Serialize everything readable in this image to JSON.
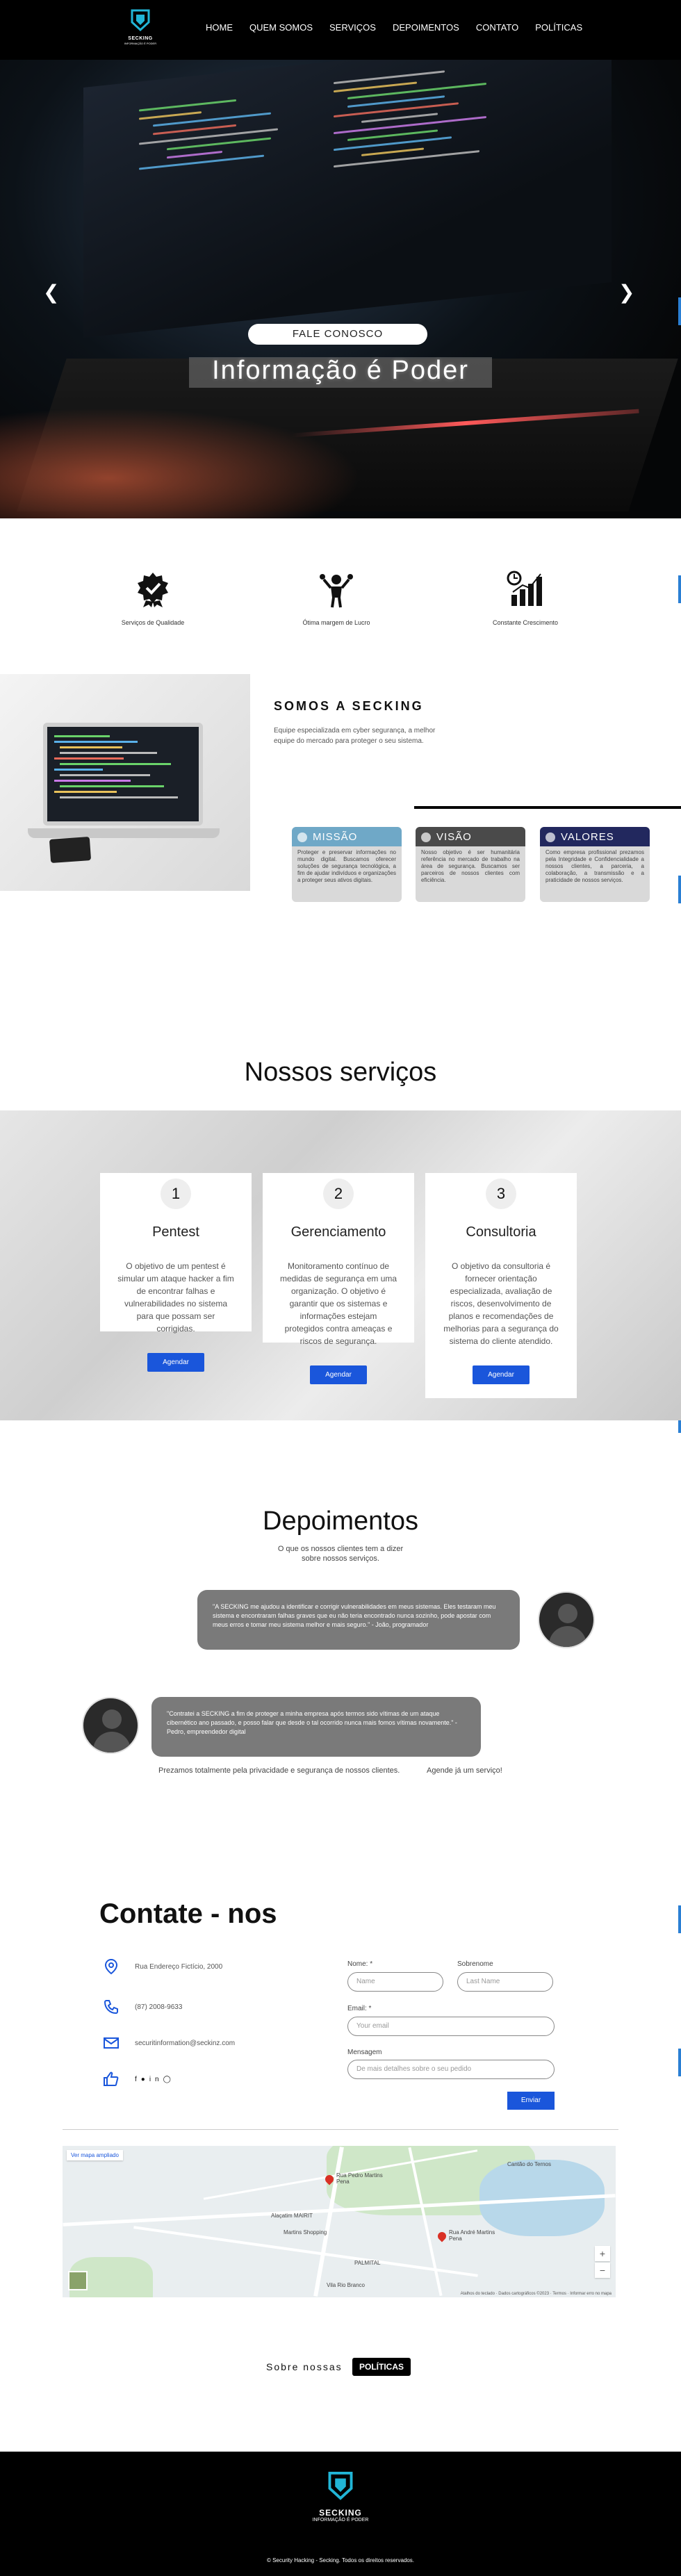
{
  "brand": {
    "name": "SECKING",
    "tagline": "INFORMAÇÃO É PODER"
  },
  "nav": {
    "items": [
      "HOME",
      "QUEM SOMOS",
      "SERVIÇOS",
      "DEPOIMENTOS",
      "CONTATO",
      "POLÍTICAS"
    ]
  },
  "hero": {
    "cta": "FALE CONOSCO",
    "title": "Informação é Poder"
  },
  "features": [
    {
      "label": "Serviços de Qualidade",
      "icon": "quality-badge-icon"
    },
    {
      "label": "Ótima margem de Lucro",
      "icon": "celebrating-person-icon"
    },
    {
      "label": "Constante Crescimento",
      "icon": "growth-chart-icon"
    }
  ],
  "about": {
    "title": "SOMOS A SECKING",
    "text": "Equipe especializada em cyber segurança, a melhor equipe do mercado para proteger o seu sistema.",
    "cards": [
      {
        "title": "MISSÃO",
        "color": "#6fa8c7",
        "text": "Proteger e preservar informações no mundo digital. Buscamos oferecer soluções de segurança tecnológica, a fim de ajudar indivíduos e organizações a proteger seus ativos digitais."
      },
      {
        "title": "VISÃO",
        "color": "#4a4a4a",
        "text": "Nosso objetivo é ser humanitária referência no mercado de trabalho na área de segurança. Buscamos ser parceiros de nossos clientes com eficiência."
      },
      {
        "title": "VALORES",
        "color": "#22285e",
        "text": "Como empresa profissional prezamos pela Integridade e Confidencialidade a nossos clientes, a parceria, a colaboração, a transmissão e a praticidade de nossos serviços."
      }
    ]
  },
  "services": {
    "title": "Nossos serviços",
    "items": [
      {
        "num": "1",
        "name": "Pentest",
        "desc": "O objetivo de um pentest é simular um ataque hacker a fim de encontrar falhas e vulnerabilidades no sistema para que possam ser corrigidas.",
        "button": "Agendar"
      },
      {
        "num": "2",
        "name": "Gerenciamento",
        "desc": "Monitoramento contínuo de medidas de segurança em uma organização. O objetivo é garantir que os sistemas e informações estejam protegidos contra ameaças e riscos de segurança.",
        "button": "Agendar"
      },
      {
        "num": "3",
        "name": "Consultoria",
        "desc": "O objetivo da consultoria é fornecer orientação especializada, avaliação de riscos, desenvolvimento de planos e recomendações de melhorias para a segurança do sistema do cliente atendido.",
        "button": "Agendar"
      }
    ]
  },
  "testimonials": {
    "title": "Depoimentos",
    "subtitle_1": "O que os nossos clientes tem a dizer",
    "subtitle_2": "sobre nossos serviços.",
    "items": [
      {
        "text": "\"A SECKING me ajudou a identificar e corrigir vulnerabilidades em meus sistemas. Eles testaram meu sistema e encontraram falhas graves que eu não teria encontrado nunca sozinho, pode apostar com meus erros e tomar meu sistema melhor e mais seguro.\" - João, programador"
      },
      {
        "text": "\"Contratei a SECKING a fim de proteger a minha empresa após termos sido vítimas de um ataque cibernético ano passado, e posso falar que desde o tal ocorrido nunca mais fomos vítimas novamente.\" - Pedro, empreendedor digital"
      }
    ],
    "footer_left": "Prezamos totalmente pela privacidade e segurança de nossos clientes.",
    "footer_right": "Agende já um serviço!"
  },
  "contact": {
    "title": "Contate - nos",
    "address": "Rua Endereço Fictício, 2000",
    "phone": "(87) 2008-9633",
    "email": "securitinformation@seckinz.com",
    "form": {
      "name_label": "Nome: *",
      "name_placeholder": "Name",
      "surname_label": "Sobrenome",
      "surname_placeholder": "Last Name",
      "email_label": "Email: *",
      "email_placeholder": "Your email",
      "message_label": "Mensagem",
      "message_placeholder": "De mais detalhes sobre o seu pedido",
      "submit": "Enviar"
    }
  },
  "map": {
    "link": "Ver mapa ampliado",
    "labels": [
      "Rua Pedro Martins Pena",
      "Alaçatim MAIRIT",
      "Martins Shopping",
      "PALMITAL",
      "Rua André Martins Pena",
      "Vila Rio Branco",
      "Cantão do Ternos"
    ],
    "attribution": "Atalhos do teclado · Dados cartográficos ©2023 · Termos · Informar erro no mapa",
    "zoom_in": "+",
    "zoom_out": "−"
  },
  "policies": {
    "text": "Sobre nossas",
    "button": "POLÍTICAS"
  },
  "footer": {
    "copy": "© Security Hacking - Secking. Todos os direitos reservados."
  }
}
